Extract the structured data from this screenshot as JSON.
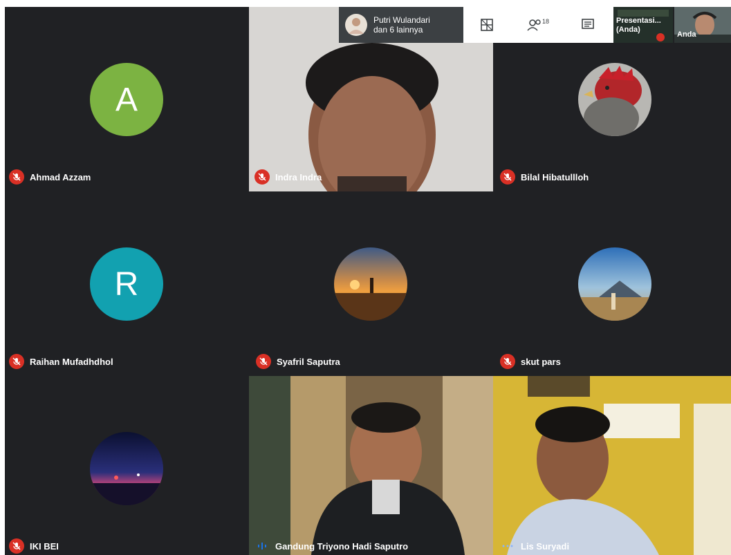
{
  "tiles": [
    {
      "name": "Ahmad Azzam",
      "initial": "A",
      "avatar_color": "#7cb342",
      "status": "muted"
    },
    {
      "name": "Indra Indra",
      "status": "muted"
    },
    {
      "name": "Bilal Hibatullloh",
      "status": "muted"
    },
    {
      "name": "Raihan Mufadhdhol",
      "initial": "R",
      "avatar_color": "#12a1b0",
      "status": "muted"
    },
    {
      "name": "Syafril Saputra",
      "status": "muted"
    },
    {
      "name": "skut pars",
      "status": "muted"
    },
    {
      "name": "IKI BEI",
      "status": "muted"
    },
    {
      "name": "Gandung Triyono Hadi Saputro",
      "status": "speaking"
    },
    {
      "name": "Lis Suryadi",
      "status": "connecting"
    }
  ],
  "topbar": {
    "participants_label_line1": "Putri Wulandari",
    "participants_label_line2": "dan 6 lainnya",
    "people_count": "18",
    "self_presentation_label_line1": "Presentasi...",
    "self_presentation_label_line2": "(Anda)",
    "self_video_label": "Anda",
    "icons": [
      "layout-icon",
      "people-icon",
      "chat-icon"
    ]
  },
  "colors": {
    "background": "#202124",
    "muted_badge": "#d93025",
    "speaking": "#1a73e8"
  }
}
